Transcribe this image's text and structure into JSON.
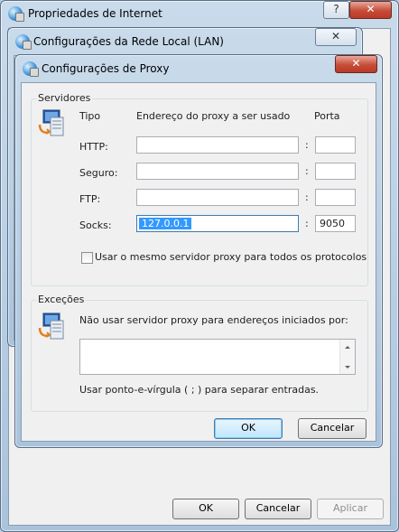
{
  "windows": {
    "internet_properties": {
      "title": "Propriedades de Internet",
      "help_label": "?",
      "close_label": "✕",
      "ok_label": "OK",
      "cancel_label": "Cancelar",
      "apply_label": "Aplicar"
    },
    "lan_settings": {
      "title": "Configurações da Rede Local (LAN)",
      "close_label": "✕"
    },
    "proxy_settings": {
      "title": "Configurações de Proxy",
      "close_label": "✕"
    }
  },
  "servers": {
    "group_label": "Servidores",
    "header_type": "Tipo",
    "header_address": "Endereço do proxy a ser usado",
    "header_port": "Porta",
    "rows": [
      {
        "type": "HTTP:",
        "address": "",
        "port": ""
      },
      {
        "type": "Seguro:",
        "address": "",
        "port": ""
      },
      {
        "type": "FTP:",
        "address": "",
        "port": ""
      },
      {
        "type": "Socks:",
        "address": "127.0.0.1",
        "port": "9050"
      }
    ],
    "colon": ":",
    "same_proxy_label": "Usar o mesmo servidor proxy para todos os protocolos",
    "same_proxy_checked": false
  },
  "exceptions": {
    "group_label": "Exceções",
    "description": "Não usar servidor proxy para endereços iniciados por:",
    "value": "",
    "hint": "Usar ponto-e-vírgula ( ; ) para separar entradas."
  },
  "dialog_buttons": {
    "ok_label": "OK",
    "cancel_label": "Cancelar"
  },
  "colors": {
    "selection": "#3399ff",
    "close_button": "#c74c38",
    "glass_frame": "#b9cde0"
  }
}
